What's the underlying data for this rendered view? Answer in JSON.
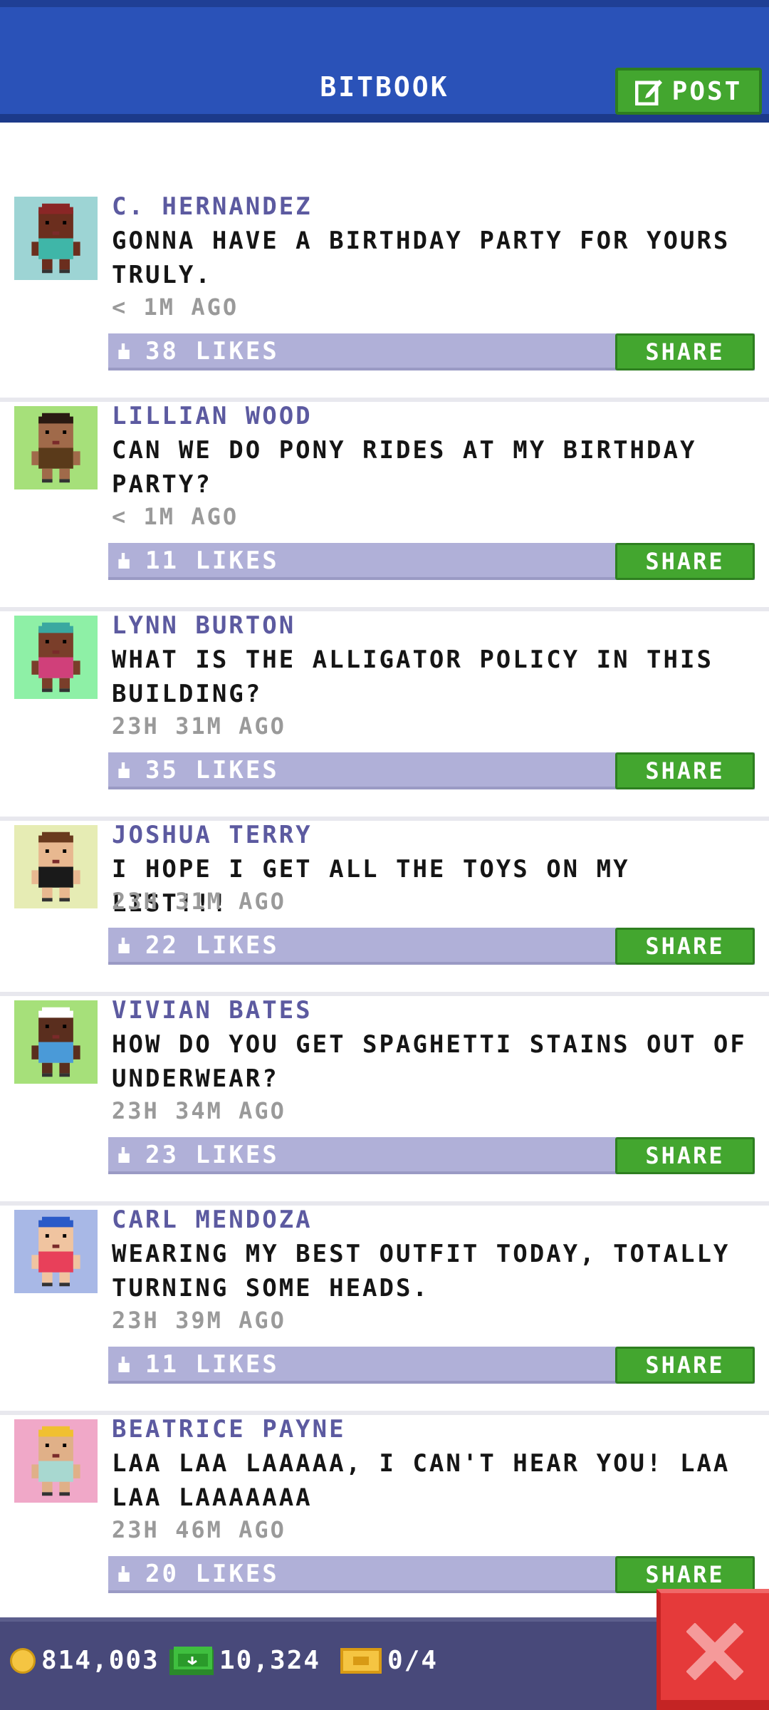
{
  "header": {
    "title": "BITBOOK",
    "post_label": "POST"
  },
  "share_label": "SHARE",
  "posts": [
    {
      "author": "C. HERNANDEZ",
      "message": "GONNA HAVE A BIRTHDAY PARTY FOR YOURS TRULY.",
      "time": "< 1M AGO",
      "likes": "38 LIKES",
      "avatar_bg": "#9dd4d4",
      "skin": "#6b2e1e",
      "hair": "#8a2626",
      "shirt": "#3fb6a8"
    },
    {
      "author": "LILLIAN WOOD",
      "message": "CAN WE DO PONY RIDES AT MY BIRTHDAY PARTY?",
      "time": "< 1M AGO",
      "likes": "11 LIKES",
      "avatar_bg": "#a6e07a",
      "skin": "#a06a4a",
      "hair": "#2a1a12",
      "shirt": "#5a3a1a"
    },
    {
      "author": "LYNN BURTON",
      "message": "WHAT IS THE ALLIGATOR POLICY IN THIS BUILDING?",
      "time": "23H 31M AGO",
      "likes": "35 LIKES",
      "avatar_bg": "#8ef0a6",
      "skin": "#7a3e2a",
      "hair": "#3aa8a0",
      "shirt": "#d0407a"
    },
    {
      "author": "JOSHUA TERRY",
      "message": "I HOPE I GET ALL THE TOYS ON MY LIST!!!",
      "time": "23H 31M AGO",
      "likes": "22 LIKES",
      "avatar_bg": "#e6ecb4",
      "skin": "#e8b890",
      "hair": "#6a3a1e",
      "shirt": "#1a1a1a"
    },
    {
      "author": "VIVIAN BATES",
      "message": "HOW DO YOU GET SPAGHETTI STAINS OUT OF UNDERWEAR?",
      "time": "23H 34M AGO",
      "likes": "23 LIKES",
      "avatar_bg": "#a6e07a",
      "skin": "#5a2e1e",
      "hair": "#ffffff",
      "shirt": "#4a9ad8"
    },
    {
      "author": "CARL MENDOZA",
      "message": "WEARING MY BEST OUTFIT TODAY, TOTALLY TURNING SOME HEADS.",
      "time": "23H 39M AGO",
      "likes": "11 LIKES",
      "avatar_bg": "#a8b8e6",
      "skin": "#f0c4a0",
      "hair": "#2a5ac8",
      "shirt": "#e8405a"
    },
    {
      "author": "BEATRICE PAYNE",
      "message": "LAA LAA LAAAAA, I CAN'T HEAR YOU! LAA LAA LAAAAAAA",
      "time": "23H 46M AGO",
      "likes": "20 LIKES",
      "avatar_bg": "#f0a8c8",
      "skin": "#e0b088",
      "hair": "#f0c030",
      "shirt": "#a8d8d0"
    }
  ],
  "bottom_bar": {
    "coins": "814,003",
    "bux": "10,324",
    "tickets": "0/4"
  }
}
